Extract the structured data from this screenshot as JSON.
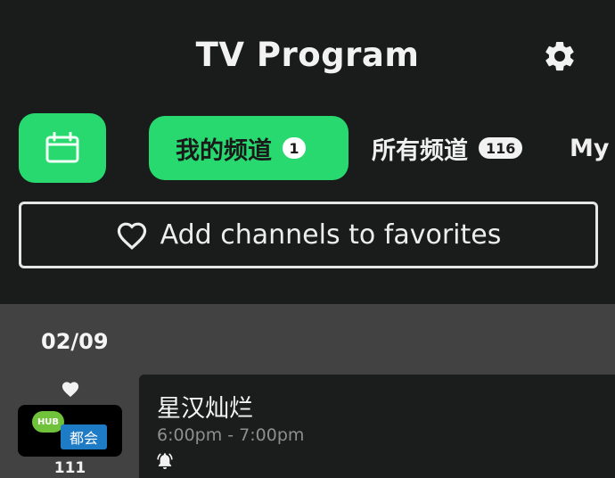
{
  "header": {
    "title": "TV Program",
    "settings_icon": "gear-icon"
  },
  "toolbar": {
    "calendar_icon": "calendar-icon"
  },
  "tabs": [
    {
      "label": "我的频道",
      "badge": "1",
      "active": true
    },
    {
      "label": "所有频道",
      "badge": "116",
      "active": false
    },
    {
      "label": "My",
      "badge": "",
      "active": false
    }
  ],
  "favorites_bar": {
    "icon": "heart-outline-icon",
    "label": "Add channels to favorites"
  },
  "schedule": {
    "date": "02/09",
    "channel": {
      "favorite_icon": "heart-filled-icon",
      "logo": {
        "badge": "HUB",
        "name": "都会"
      },
      "number": "111"
    },
    "program": {
      "title": "星汉灿烂",
      "time": "6:00pm - 7:00pm",
      "reminder_icon": "bell-icon"
    }
  },
  "colors": {
    "background": "#191c1a",
    "accent": "#27d96e",
    "content_bg": "#424242",
    "card_bg": "#1b1d1c",
    "muted_text": "#8e8e8e"
  }
}
